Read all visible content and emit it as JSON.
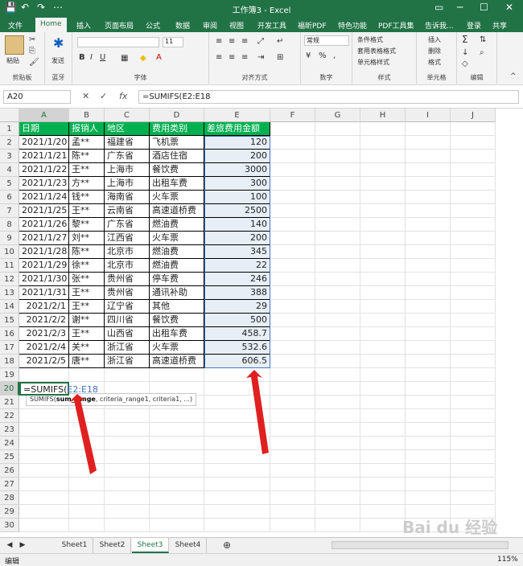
{
  "window": {
    "title": "工作簿3 - Excel",
    "quick_access": [
      "💾",
      "↶",
      "↷",
      "⋯"
    ],
    "controls": [
      "▭",
      "─",
      "☐",
      "✕"
    ]
  },
  "menu": {
    "tabs": [
      "文件",
      "Home",
      "插入",
      "页面布局",
      "公式",
      "数据",
      "审阅",
      "视图",
      "开发工具",
      "福昕PDF",
      "特色功能",
      "PDF工具集"
    ],
    "tell_me": "告诉我...",
    "login": "登录",
    "share": "共享"
  },
  "ribbon": {
    "clipboard": {
      "label": "剪贴板",
      "paste": "粘贴"
    },
    "bluetooth": {
      "label": "蓝牙",
      "send": "发送"
    },
    "font": {
      "label": "字体",
      "size": "11",
      "bold": "B",
      "italic": "I",
      "underline": "U"
    },
    "align": {
      "label": "对齐方式"
    },
    "number": {
      "label": "数字",
      "format": "常规"
    },
    "styles": {
      "label": "样式",
      "conditional": "条件格式",
      "table": "套用表格格式",
      "cell": "单元格样式"
    },
    "cells": {
      "label": "单元格",
      "insert": "插入",
      "delete": "删除",
      "format": "格式"
    },
    "edit": {
      "label": "编辑"
    }
  },
  "formula_bar": {
    "name_box": "A20",
    "cancel": "✕",
    "enter": "✓",
    "fx": "fx",
    "formula": "=SUMIFS(E2:E18"
  },
  "columns": [
    "A",
    "B",
    "C",
    "D",
    "E",
    "F",
    "G",
    "H",
    "I",
    "J"
  ],
  "rows": [
    "1",
    "2",
    "3",
    "4",
    "5",
    "6",
    "7",
    "8",
    "9",
    "10",
    "11",
    "12",
    "13",
    "14",
    "15",
    "16",
    "17",
    "18",
    "19",
    "20",
    "21",
    "22",
    "23",
    "24",
    "25",
    "26",
    "27",
    "28",
    "29",
    "30"
  ],
  "table": {
    "headers": [
      "日期",
      "报销人",
      "地区",
      "费用类别",
      "差旅费用金额"
    ],
    "rows": [
      [
        "2021/1/20",
        "孟**",
        "福建省",
        "飞机票",
        "120"
      ],
      [
        "2021/1/21",
        "陈**",
        "广东省",
        "酒店住宿",
        "200"
      ],
      [
        "2021/1/22",
        "王**",
        "上海市",
        "餐饮费",
        "3000"
      ],
      [
        "2021/1/23",
        "方**",
        "上海市",
        "出租车费",
        "300"
      ],
      [
        "2021/1/24",
        "钱**",
        "海南省",
        "火车票",
        "100"
      ],
      [
        "2021/1/25",
        "王**",
        "云南省",
        "高速道桥费",
        "2500"
      ],
      [
        "2021/1/26",
        "黎**",
        "广东省",
        "燃油费",
        "140"
      ],
      [
        "2021/1/27",
        "刘**",
        "江西省",
        "火车票",
        "200"
      ],
      [
        "2021/1/28",
        "陈**",
        "北京市",
        "燃油费",
        "345"
      ],
      [
        "2021/1/29",
        "徐**",
        "北京市",
        "燃油费",
        "22"
      ],
      [
        "2021/1/30",
        "张**",
        "贵州省",
        "停车费",
        "246"
      ],
      [
        "2021/1/31",
        "王**",
        "贵州省",
        "通讯补助",
        "388"
      ],
      [
        "2021/2/1",
        "王**",
        "辽宁省",
        "其他",
        "29"
      ],
      [
        "2021/2/2",
        "谢**",
        "四川省",
        "餐饮费",
        "500"
      ],
      [
        "2021/2/3",
        "王**",
        "山西省",
        "出租车费",
        "458.7"
      ],
      [
        "2021/2/4",
        "关**",
        "浙江省",
        "火车票",
        "532.6"
      ],
      [
        "2021/2/5",
        "唐**",
        "浙江省",
        "高速道桥费",
        "606.5"
      ]
    ]
  },
  "editing": {
    "prefix": "=SUMIFS(",
    "ref": "E2:E18"
  },
  "tooltip": {
    "func": "SUMIFS(",
    "arg_bold": "sum_range",
    "rest": ", criteria_range1, criteria1, ...)"
  },
  "sheets": [
    "Sheet1",
    "Sheet2",
    "Sheet3",
    "Sheet4"
  ],
  "active_sheet": "Sheet3",
  "status": {
    "mode": "编辑",
    "zoom": "115%"
  },
  "watermark": "Bai du 经验",
  "colors": {
    "excel_green": "#217346",
    "header_fill": "#00b050",
    "arrow": "#e02020",
    "ref_blue": "#4472c4"
  }
}
